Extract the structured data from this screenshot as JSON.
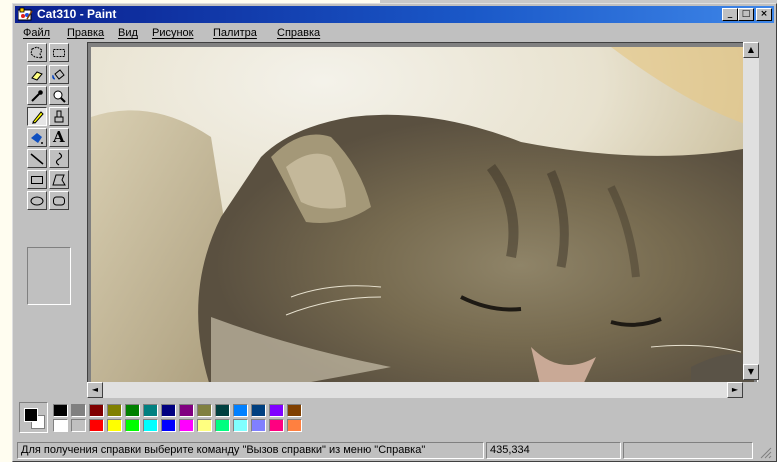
{
  "window": {
    "title": "Cat310 - Paint",
    "minimize": "_",
    "maximize": "□",
    "close": "×"
  },
  "menu": [
    "Файл",
    "Правка",
    "Вид",
    "Рисунок",
    "Палитра",
    "Справка"
  ],
  "tools": [
    {
      "name": "free-form-select-icon"
    },
    {
      "name": "rect-select-icon"
    },
    {
      "name": "eraser-icon"
    },
    {
      "name": "fill-bucket-icon"
    },
    {
      "name": "pick-color-icon"
    },
    {
      "name": "magnifier-icon"
    },
    {
      "name": "pencil-icon",
      "selected": true
    },
    {
      "name": "brush-icon"
    },
    {
      "name": "airbrush-icon"
    },
    {
      "name": "text-icon",
      "label": "A"
    },
    {
      "name": "line-icon"
    },
    {
      "name": "curve-icon"
    },
    {
      "name": "rectangle-icon"
    },
    {
      "name": "polygon-icon"
    },
    {
      "name": "ellipse-icon"
    },
    {
      "name": "rounded-rect-icon"
    }
  ],
  "scroll": {
    "up": "▲",
    "down": "▼",
    "left": "◄",
    "right": "►"
  },
  "palette": {
    "foreground": "#000000",
    "background": "#ffffff",
    "colors_top": [
      "#000000",
      "#808080",
      "#800000",
      "#808000",
      "#008000",
      "#008080",
      "#000080",
      "#800080",
      "#808040",
      "#004040",
      "#0080ff",
      "#004080",
      "#8000ff",
      "#804000"
    ],
    "colors_bottom": [
      "#ffffff",
      "#c0c0c0",
      "#ff0000",
      "#ffff00",
      "#00ff00",
      "#00ffff",
      "#0000ff",
      "#ff00ff",
      "#ffff80",
      "#00ff80",
      "#80ffff",
      "#8080ff",
      "#ff0080",
      "#ff8040"
    ]
  },
  "status": {
    "help_text": "Для получения справки выберите команду \"Вызов справки\" из меню \"Справка\"",
    "coords": "435,334"
  }
}
